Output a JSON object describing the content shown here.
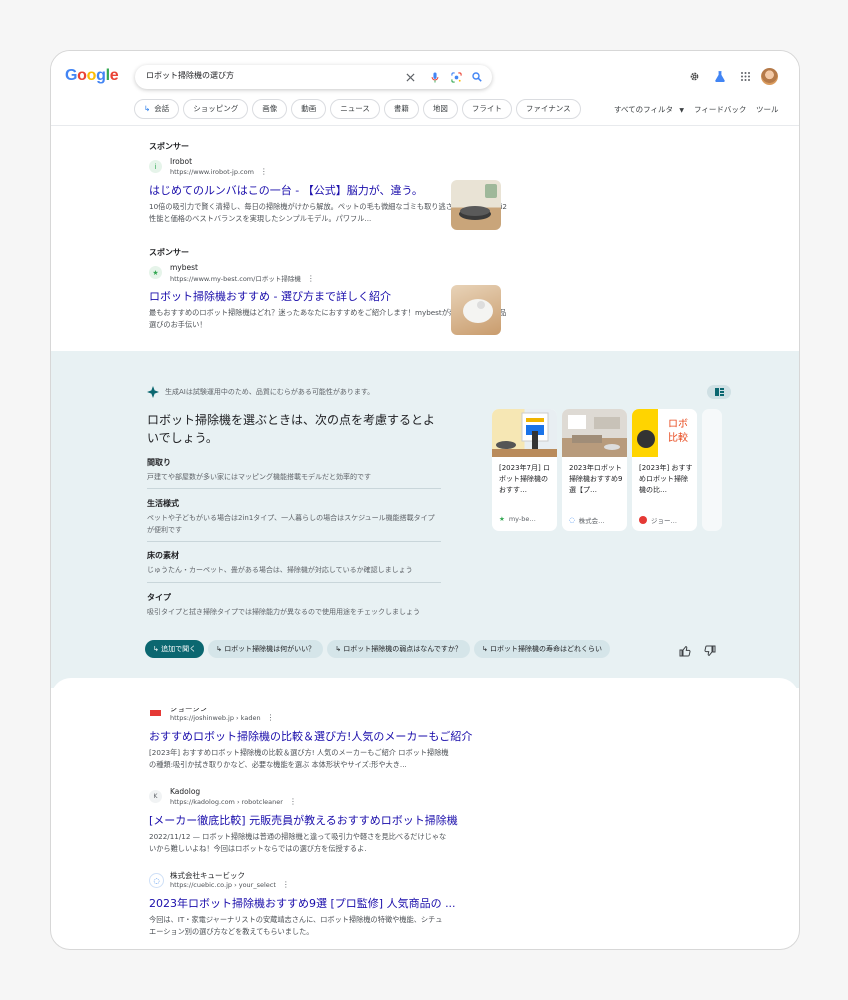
{
  "header": {
    "logo": "Google",
    "query": "ロボット掃除機の選び方",
    "chips": [
      "会話",
      "ショッピング",
      "画像",
      "動画",
      "ニュース",
      "書籍",
      "地図",
      "フライト",
      "ファイナンス"
    ],
    "all_filters": "すべてのフィルタ",
    "feedback": "フィードバック",
    "tools": "ツール"
  },
  "ads": [
    {
      "sponsor": "スポンサー",
      "site": "Irobot",
      "url": "https://www.irobot-jp.com",
      "title": "はじめてのルンバはこの一台 - 【公式】脳力が、違う。",
      "desc": "10倍の吸引力で賢く清掃し、毎日の掃除機がけから解放。ペットの毛も微細なゴミも取り逃さない。 ルンバ i2 性能と価格のベストバランスを実現したシンプルモデル。パワフル..."
    },
    {
      "sponsor": "スポンサー",
      "site": "mybest",
      "url": "https://www.my-best.com/ロボット掃除機",
      "title": "ロボット掃除機おすすめ - 選び方まで詳しく紹介",
      "desc": "最もおすすめのロボット掃除機はどれ？迷ったあなたにおすすめをご紹介します！mybestが楽しく簡単な商品選びのお手伝い！"
    }
  ],
  "ai": {
    "note": "生成AIは試験運用中のため、品質にむらがある可能性があります。",
    "heading": "ロボット掃除機を選ぶときは、次の点を考慮するとよいでしょう。",
    "items": [
      {
        "title": "間取り",
        "text": "戸建てや部屋数が多い家にはマッピング機能搭載モデルだと効率的です"
      },
      {
        "title": "生活様式",
        "text": "ペットや子どもがいる場合は2in1タイプ、一人暮らしの場合はスケジュール機能搭載タイプが便利です"
      },
      {
        "title": "床の素材",
        "text": "じゅうたん・カーペット、畳がある場合は、掃除機が対応しているか確認しましょう"
      },
      {
        "title": "タイプ",
        "text": "吸引タイプと拭き掃除タイプでは掃除能力が異なるので使用用途をチェックしましょう"
      }
    ],
    "cards": [
      {
        "text": "[2023年7月] ロボット掃除機のおすす…",
        "source": "my-be…"
      },
      {
        "text": "2023年ロボット掃除機おすすめ9選【プ…",
        "source": "株式会…"
      },
      {
        "text": "[2023年] おすすめロボット掃除機の比…",
        "source": "ジョー…"
      }
    ],
    "followups": [
      "追加で聞く",
      "ロボット掃除機は何がいい？",
      "ロボット掃除機の弱点はなんですか？",
      "ロボット掃除機の寿命はどれくらい"
    ]
  },
  "results": [
    {
      "site": "ジョーシン",
      "url": "https://joshinweb.jp › kaden",
      "title": "おすすめロボット掃除機の比較＆選び方!人気のメーカーもご紹介",
      "desc": "[2023年] おすすめロボット掃除機の比較＆選び方! 人気のメーカーもご紹介 ロボット掃除機の種類:吸引か拭き取りかなど、必要な機能を選ぶ 本体形状やサイズ:形や大き..."
    },
    {
      "site": "Kadolog",
      "url": "https://kadolog.com › robotcleaner",
      "title": "[メーカー徹底比較] 元販売員が教えるおすすめロボット掃除機",
      "desc": "2022/11/12 — ロボット掃除機は普通の掃除機と違って吸引力や軽さを見比べるだけじゃないから難しいよね！今回はロボットならではの選び方を伝授するよ."
    },
    {
      "site": "株式会社キュービック",
      "url": "https://cuebic.co.jp › your_select",
      "title": "2023年ロボット掃除機おすすめ9選 [プロ監修] 人気商品の ...",
      "desc": "今回は、IT・家電ジャーナリストの安蔵靖志さんに、ロボット掃除機の特徴や機能、シチュエーション別の選び方などを教えてもらいました。"
    }
  ],
  "colors": {
    "link": "#1a0dab",
    "ai_bg": "#e8f1f3",
    "accent": "#0b6770"
  }
}
